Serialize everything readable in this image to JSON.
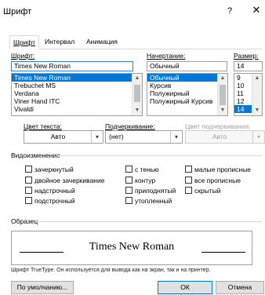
{
  "window": {
    "title": "Шрифт",
    "help": "?",
    "close": "✕"
  },
  "tabs": [
    {
      "label": "Шрифт"
    },
    {
      "label": "Интервал"
    },
    {
      "label": "Анимация"
    }
  ],
  "font": {
    "label": "Шрифт:",
    "value": "Times New Roman",
    "items": [
      "Times New Roman",
      "Trebuchet MS",
      "Verdana",
      "Viner Hand ITC",
      "Vivaldi"
    ],
    "selected_index": 0
  },
  "style": {
    "label": "Начертание:",
    "value": "Обычный",
    "items": [
      "Обычный",
      "Курсив",
      "Полужирный",
      "Полужирный Курсив"
    ],
    "selected_index": 0
  },
  "size": {
    "label": "Размер:",
    "value": "14",
    "items": [
      "9",
      "10",
      "11",
      "12",
      "14"
    ],
    "selected_index": 4
  },
  "color": {
    "label": "Цвет текста:",
    "value": "Авто"
  },
  "underline": {
    "label": "Подчеркивание:",
    "value": "(нет)"
  },
  "underline_color": {
    "label": "Цвет подчеркивания:",
    "value": "Авто"
  },
  "effects": {
    "label": "Видоизменение",
    "col1": [
      "зачеркнутый",
      "двойное зачеркивание",
      "надстрочный",
      "подстрочный"
    ],
    "col2": [
      "с тенью",
      "контур",
      "приподнятый",
      "утопленный"
    ],
    "col3": [
      "малые прописные",
      "все прописные",
      "скрытый"
    ]
  },
  "preview": {
    "label": "Образец",
    "text": "Times New Roman",
    "note": "Шрифт TrueType. Он используется для вывода как на экран, так и на принтер."
  },
  "buttons": {
    "default": "По умолчанию...",
    "ok": "ОК",
    "cancel": "Отмена"
  },
  "colors": {
    "selection": "#0078d7",
    "focus_border": "#3a7bd5"
  }
}
